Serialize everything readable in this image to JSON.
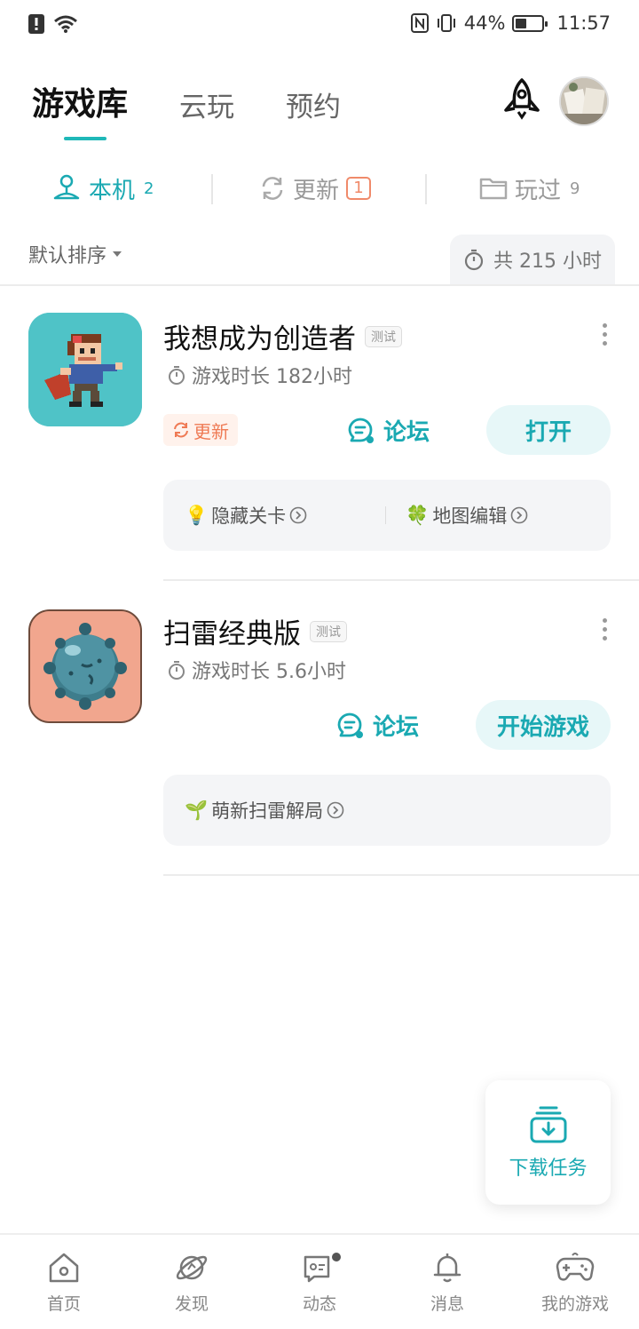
{
  "status_bar": {
    "battery_percent": "44%",
    "battery_level": 0.44,
    "time": "11:57",
    "icons": [
      "alert-icon",
      "wifi-icon",
      "nfc-icon",
      "vibrate-icon",
      "battery-icon"
    ]
  },
  "header": {
    "tabs": [
      {
        "label": "游戏库",
        "active": true
      },
      {
        "label": "云玩",
        "active": false
      },
      {
        "label": "预约",
        "active": false
      }
    ],
    "icons": [
      "rocket-icon",
      "avatar"
    ]
  },
  "sub_tabs": [
    {
      "label": "本机",
      "count": "2",
      "icon": "local-device-icon",
      "active": true
    },
    {
      "label": "更新",
      "count": "1",
      "icon": "refresh-icon",
      "active": false
    },
    {
      "label": "玩过",
      "count": "9",
      "icon": "folder-icon",
      "active": false
    }
  ],
  "sort": {
    "label": "默认排序"
  },
  "total": {
    "label": "共 215 小时"
  },
  "games": [
    {
      "title": "我想成为创造者",
      "badge": "测试",
      "playtime": "游戏时长 182小时",
      "update_label": "更新",
      "forum_label": "论坛",
      "action_label": "打开",
      "tips": [
        {
          "emoji": "💡",
          "label": "隐藏关卡"
        },
        {
          "emoji": "🍀",
          "label": "地图编辑"
        }
      ]
    },
    {
      "title": "扫雷经典版",
      "badge": "测试",
      "playtime": "游戏时长 5.6小时",
      "forum_label": "论坛",
      "action_label": "开始游戏",
      "tips": [
        {
          "emoji": "🌱",
          "label": "萌新扫雷解局"
        }
      ]
    }
  ],
  "download_fab": {
    "label": "下载任务"
  },
  "bottom_nav": [
    {
      "label": "首页",
      "icon": "home-icon"
    },
    {
      "label": "发现",
      "icon": "discover-planet-icon"
    },
    {
      "label": "动态",
      "icon": "feed-icon"
    },
    {
      "label": "消息",
      "icon": "bell-icon"
    },
    {
      "label": "我的游戏",
      "icon": "gamepad-icon"
    }
  ],
  "colors": {
    "accent": "#1aa9b2",
    "update_orange": "#ef7a54",
    "tip_bg": "#f4f5f7"
  }
}
